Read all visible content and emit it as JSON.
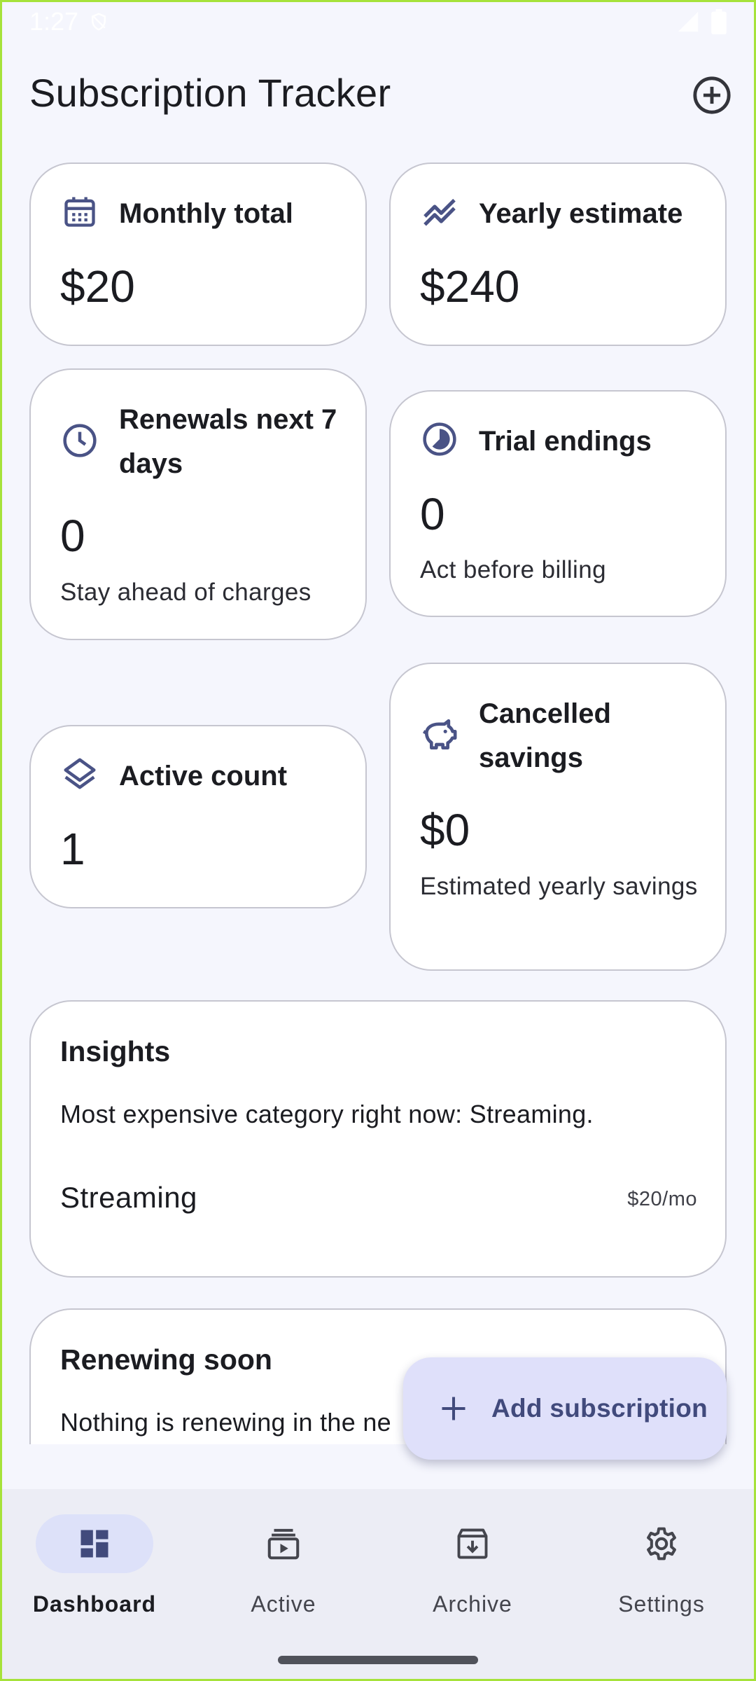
{
  "status_bar": {
    "time": "1:27"
  },
  "header": {
    "title": "Subscription Tracker"
  },
  "cards": {
    "monthly_total": {
      "title": "Monthly total",
      "value": "$20"
    },
    "yearly_estimate": {
      "title": "Yearly estimate",
      "value": "$240"
    },
    "renewals": {
      "title": "Renewals next 7 days",
      "value": "0",
      "subtitle": "Stay ahead of charges"
    },
    "trial_endings": {
      "title": "Trial endings",
      "value": "0",
      "subtitle": "Act before billing"
    },
    "active_count": {
      "title": "Active count",
      "value": "1"
    },
    "cancelled_savings": {
      "title": "Cancelled savings",
      "value": "$0",
      "subtitle": "Estimated yearly savings"
    }
  },
  "insights": {
    "title": "Insights",
    "text": "Most expensive category right now: Streaming.",
    "category_label": "Streaming",
    "category_value": "$20/mo"
  },
  "renewing_soon": {
    "title": "Renewing soon",
    "text": "Nothing is renewing in the ne"
  },
  "fab": {
    "label": "Add subscription"
  },
  "bottom_nav": {
    "items": [
      {
        "label": "Dashboard",
        "icon": "dashboard-icon",
        "active": true
      },
      {
        "label": "Active",
        "icon": "subscriptions-icon",
        "active": false
      },
      {
        "label": "Archive",
        "icon": "archive-icon",
        "active": false
      },
      {
        "label": "Settings",
        "icon": "gear-icon",
        "active": false
      }
    ]
  },
  "colors": {
    "accent": "#4a5386",
    "background": "#f5f6fd",
    "fab": "#dfe0fa",
    "nav_active_pill": "#dde1f9"
  }
}
